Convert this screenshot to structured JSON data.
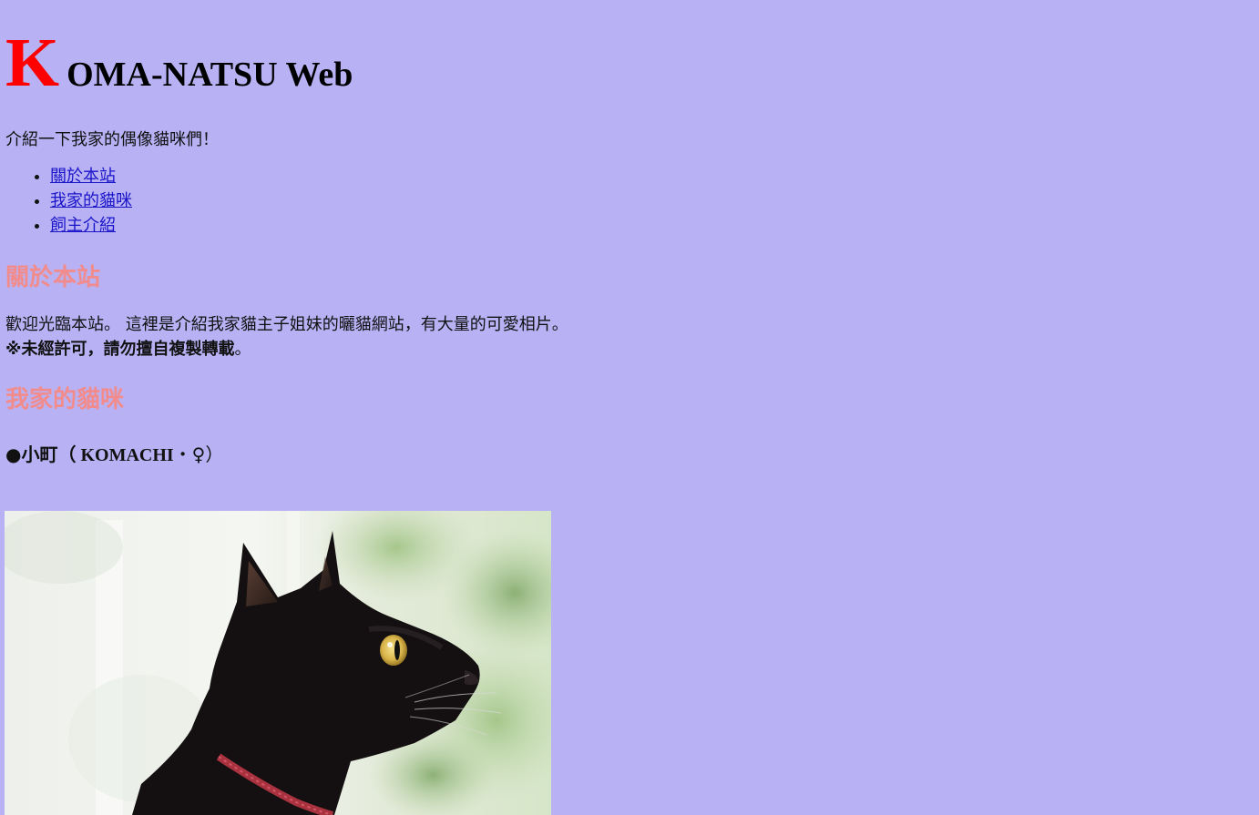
{
  "header": {
    "title_initial": "K",
    "title_rest": "OMA-NATSU Web"
  },
  "intro": "介紹一下我家的偶像貓咪們！",
  "nav": {
    "items": [
      {
        "label": "關於本站"
      },
      {
        "label": "我家的貓咪"
      },
      {
        "label": "飼主介紹"
      }
    ]
  },
  "about": {
    "heading": "關於本站",
    "text": "歡迎光臨本站。 這裡是介紹我家貓主子姐妹的曬貓網站，有大量的可愛相片。",
    "notice": "※未經許可，請勿擅自複製轉載",
    "notice_end": "。"
  },
  "cats": {
    "heading": "我家的貓咪",
    "cat1": {
      "prefix": "●小町（",
      "latin": " KOMACHI",
      "separator": "・",
      "symbol": "♀",
      "suffix": "）"
    }
  },
  "colors": {
    "background": "#b8b2f5",
    "title_initial": "#ff0000",
    "section_heading": "#f28b8b",
    "link": "#1a14c9"
  }
}
